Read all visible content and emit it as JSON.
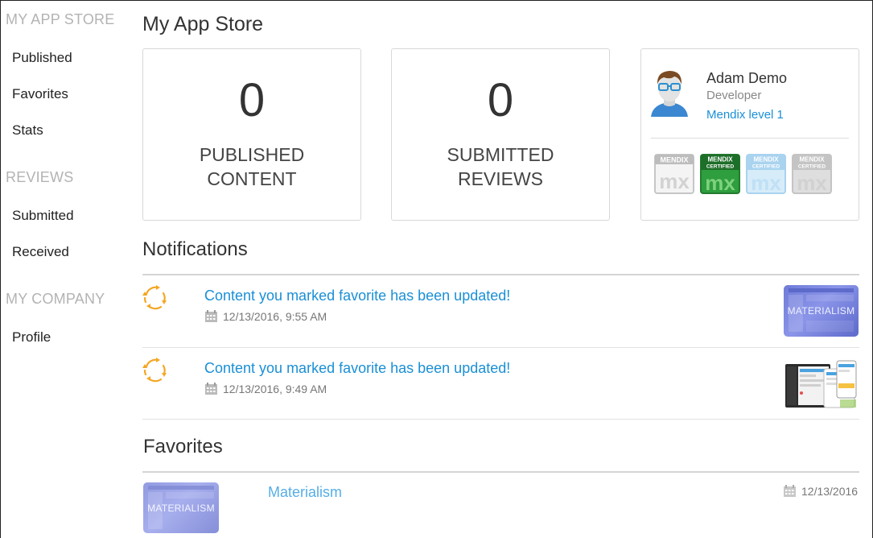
{
  "sidebar": {
    "sections": [
      {
        "heading": "MY APP STORE",
        "items": [
          "Published",
          "Favorites",
          "Stats"
        ]
      },
      {
        "heading": "REVIEWS",
        "items": [
          "Submitted",
          "Received"
        ]
      },
      {
        "heading": "MY COMPANY",
        "items": [
          "Profile"
        ]
      }
    ]
  },
  "main": {
    "title": "My App Store",
    "stats": [
      {
        "value": "0",
        "label_line1": "PUBLISHED",
        "label_line2": "CONTENT"
      },
      {
        "value": "0",
        "label_line1": "SUBMITTED",
        "label_line2": "REVIEWS"
      }
    ],
    "profile": {
      "name": "Adam Demo",
      "role": "Developer",
      "level": "Mendix level 1",
      "badges": [
        {
          "line1": "MENDIX",
          "line2": "",
          "mark": "mx",
          "state": "inactive-gray",
          "color": "#bdbdbd"
        },
        {
          "line1": "MENDIX",
          "line2": "CERTIFIED",
          "mark": "mx",
          "state": "active-green",
          "color": "#2e9e3e"
        },
        {
          "line1": "MENDIX",
          "line2": "CERTIFIED",
          "mark": "mx",
          "state": "inactive-blue",
          "color": "#a9d3ef"
        },
        {
          "line1": "MENDIX",
          "line2": "CERTIFIED",
          "mark": "mx",
          "state": "inactive-gray",
          "color": "#c4c4c4"
        }
      ]
    },
    "notifications": {
      "title": "Notifications",
      "items": [
        {
          "text": "Content you marked favorite has been updated!",
          "date": "12/13/2016, 9:55 AM",
          "thumb_label": "MATERIALISM",
          "icon": "refresh-icon"
        },
        {
          "text": "Content you marked favorite has been updated!",
          "date": "12/13/2016, 9:49 AM",
          "thumb_label": "",
          "icon": "refresh-icon"
        }
      ]
    },
    "favorites": {
      "title": "Favorites",
      "items": [
        {
          "name": "Materialism",
          "date": "12/13/2016",
          "thumb_label": "MATERIALISM"
        }
      ]
    }
  },
  "colors": {
    "link": "#1a8fd6",
    "sidebar_heading": "#b3b3b3",
    "refresh_icon": "#f5a623"
  }
}
